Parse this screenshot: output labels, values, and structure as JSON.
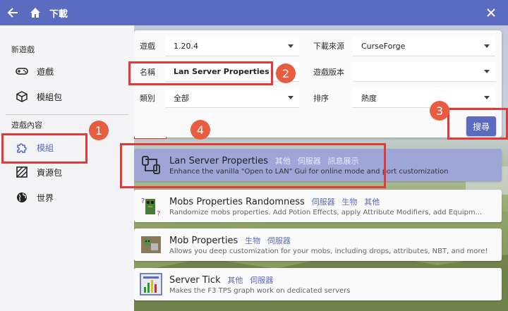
{
  "titlebar": {
    "title": "下載"
  },
  "sidebar": {
    "section_new": "新遊戲",
    "section_content": "遊戲內容",
    "items": [
      {
        "label": "遊戲",
        "icon": "gamepad-icon"
      },
      {
        "label": "模組包",
        "icon": "package-icon"
      },
      {
        "label": "模組",
        "icon": "puzzle-icon"
      },
      {
        "label": "資源包",
        "icon": "texture-icon"
      },
      {
        "label": "世界",
        "icon": "globe-icon"
      }
    ]
  },
  "filters": {
    "game_label": "遊戲",
    "game_value": "1.20.4",
    "source_label": "下載來源",
    "source_value": "CurseForge",
    "name_label": "名稱",
    "name_value": "Lan Server Properties",
    "version_label": "遊戲版本",
    "version_value": "",
    "category_label": "類別",
    "category_value": "全部",
    "sort_label": "排序",
    "sort_value": "熱度",
    "search_button": "搜尋"
  },
  "results": [
    {
      "title": "Lan Server Properties",
      "tags": [
        "其他",
        "伺服器",
        "訊息展示"
      ],
      "desc": "Enhance the vanilla \"Open to LAN\" Gui for online mode and port customization"
    },
    {
      "title": "Mobs Properties Randomness",
      "tags": [
        "伺服器",
        "生物",
        "其他"
      ],
      "desc": "Randomize mobs properties. Add Potion Effects, apply Attribute Modifiers, add Equipm..."
    },
    {
      "title": "Mob Properties",
      "tags": [
        "生物",
        "伺服器"
      ],
      "desc": "Allows you deep customization for your mobs, including drops, attributes, NBT, and more!"
    },
    {
      "title": "Server Tick",
      "tags": [
        "其他",
        "伺服器"
      ],
      "desc": "Makes the F3 TPS graph work on dedicated servers"
    }
  ],
  "annotations": [
    "1",
    "2",
    "3",
    "4"
  ],
  "colors": {
    "accent": "#5b6bbf",
    "annotation": "#e03a3a"
  }
}
